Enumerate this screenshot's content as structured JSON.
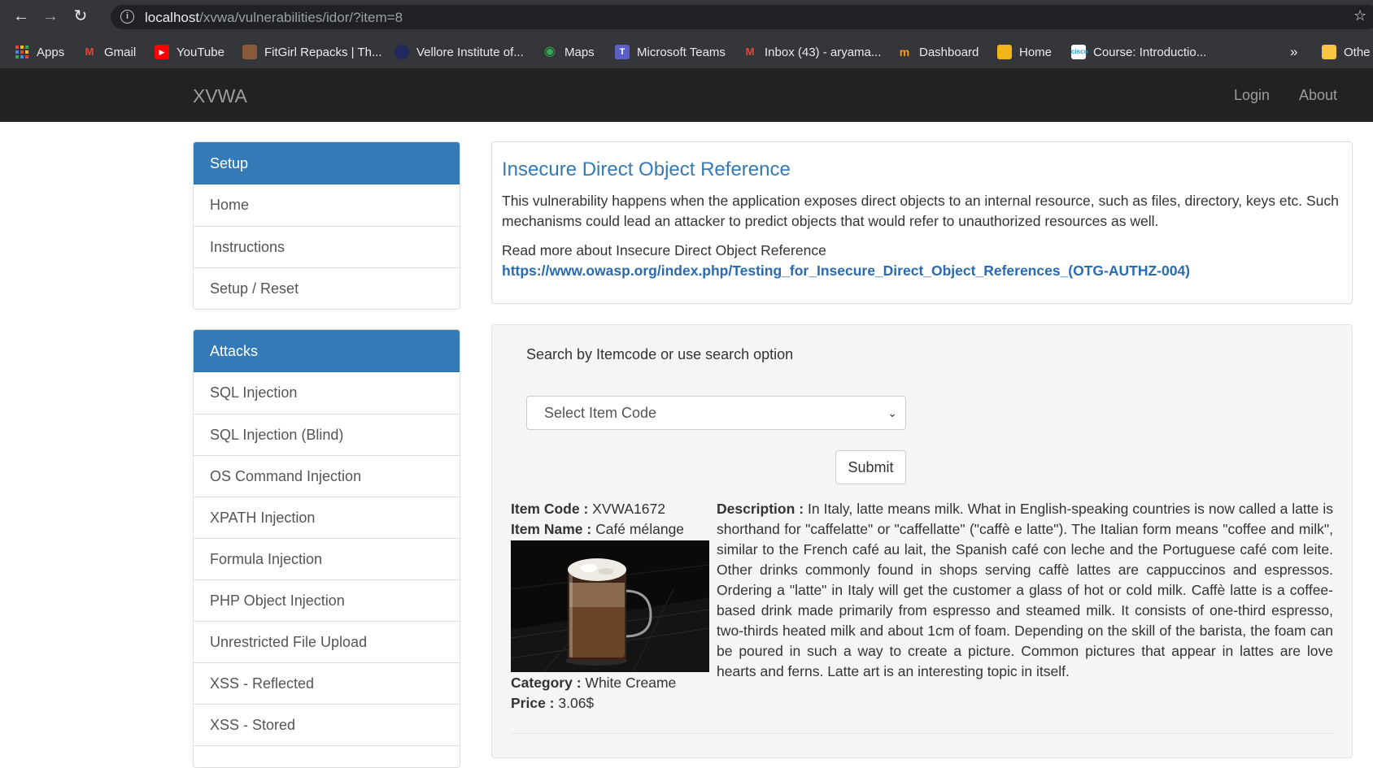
{
  "browser": {
    "url_host": "localhost",
    "url_path": "/xvwa/vulnerabilities/idor/?item=8",
    "bookmarks": [
      {
        "label": "Apps",
        "icon": "apps-grid-icon"
      },
      {
        "label": "Gmail",
        "icon": "gmail-icon"
      },
      {
        "label": "YouTube",
        "icon": "youtube-icon"
      },
      {
        "label": "FitGirl Repacks | Th...",
        "icon": "fitgirl-icon"
      },
      {
        "label": "Vellore Institute of...",
        "icon": "vit-icon"
      },
      {
        "label": "Maps",
        "icon": "maps-pin-icon"
      },
      {
        "label": "Microsoft Teams",
        "icon": "teams-icon"
      },
      {
        "label": "Inbox (43) - aryama...",
        "icon": "gmail-icon"
      },
      {
        "label": "Dashboard",
        "icon": "dashboard-icon"
      },
      {
        "label": "Home",
        "icon": "home-box-icon"
      },
      {
        "label": "Course: Introductio...",
        "icon": "cisco-icon"
      }
    ],
    "overflow": "»",
    "other": "Othe"
  },
  "app": {
    "brand": "XVWA",
    "nav": {
      "login": "Login",
      "about": "About"
    }
  },
  "sidebar": {
    "setup": {
      "title": "Setup",
      "items": [
        "Home",
        "Instructions",
        "Setup / Reset"
      ]
    },
    "attacks": {
      "title": "Attacks",
      "items": [
        "SQL Injection",
        "SQL Injection (Blind)",
        "OS Command Injection",
        "XPATH Injection",
        "Formula Injection",
        "PHP Object Injection",
        "Unrestricted File Upload",
        "XSS - Reflected",
        "XSS - Stored"
      ]
    }
  },
  "info": {
    "title": "Insecure Direct Object Reference",
    "text": "This vulnerability happens when the application exposes direct objects to an internal resource, such as files, directory, keys etc. Such mechanisms could lead an attacker to predict objects that would refer to unauthorized resources as well.",
    "read_more": "Read more about Insecure Direct Object Reference",
    "link": "https://www.owasp.org/index.php/Testing_for_Insecure_Direct_Object_References_(OTG-AUTHZ-004)"
  },
  "search": {
    "label": "Search by Itemcode or use search option",
    "select_value": "Select Item Code",
    "submit": "Submit"
  },
  "item": {
    "code_label": "Item Code :",
    "code": "XVWA1672",
    "name_label": "Item Name :",
    "name": "Café mélange",
    "category_label": "Category :",
    "category": "White Creame",
    "price_label": "Price :",
    "price": "3.06$",
    "desc_label": "Description :",
    "description": "In Italy, latte means milk. What in English-speaking countries is now called a latte is shorthand for \"caffelatte\" or \"caffellatte\" (\"caffè e latte\"). The Italian form means \"coffee and milk\", similar to the French café au lait, the Spanish café con leche and the Portuguese café com leite. Other drinks commonly found in shops serving caffè lattes are cappuccinos and espressos. Ordering a \"latte\" in Italy will get the customer a glass of hot or cold milk. Caffè latte is a coffee-based drink made primarily from espresso and steamed milk. It consists of one-third espresso, two-thirds heated milk and about 1cm of foam. Depending on the skill of the barista, the foam can be poured in such a way to create a picture. Common pictures that appear in lattes are love hearts and ferns. Latte art is an interesting topic in itself."
  }
}
